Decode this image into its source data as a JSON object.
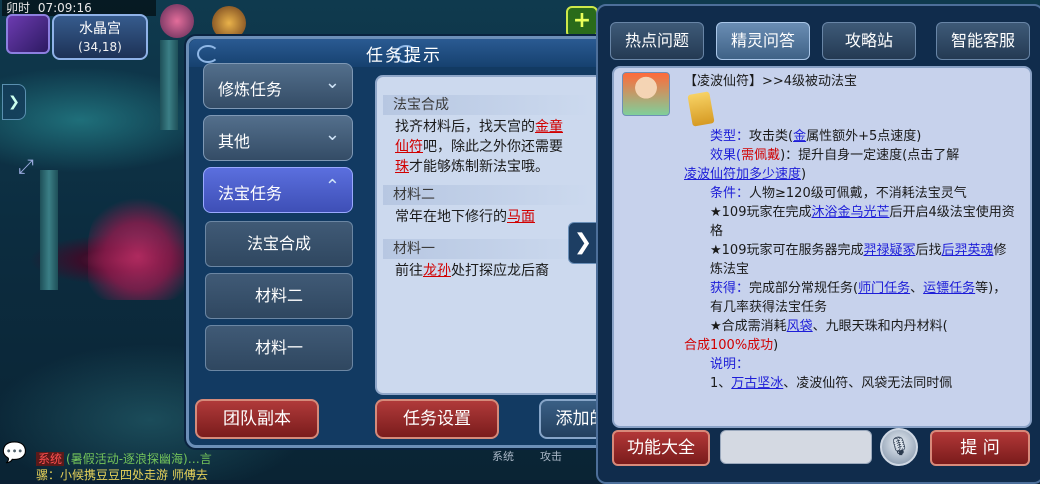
{
  "hud": {
    "period": "卯时",
    "clock": "07:09:16",
    "location_name": "水晶宫",
    "coordinates": "(34,18)"
  },
  "task_dialog": {
    "title": "任务提示",
    "categories": [
      {
        "label": "修炼任务",
        "expanded": false
      },
      {
        "label": "其他",
        "expanded": false
      },
      {
        "label": "法宝任务",
        "expanded": true
      }
    ],
    "sub_items": [
      "法宝合成",
      "材料二",
      "材料一"
    ],
    "sections": [
      {
        "heading": "法宝合成",
        "lines": [
          {
            "pre": "找齐材料后，找天宫的",
            "link": "金童",
            "post": ""
          },
          {
            "pre": "",
            "link": "仙符",
            "post": "吧，除此之外你还需要"
          },
          {
            "pre": "",
            "link": "珠",
            "post": "才能够炼制新法宝哦。"
          }
        ]
      },
      {
        "heading": "材料二",
        "lines": [
          {
            "pre": "常年在地下修行的",
            "link": "马面",
            "post": ""
          }
        ]
      },
      {
        "heading": "材料一",
        "lines": [
          {
            "pre": "前往",
            "link": "龙孙",
            "post": "处打探应龙后裔"
          }
        ]
      }
    ],
    "team_dungeon_label": "团队副本",
    "task_settings_label": "任务设置",
    "add_label": "添加的"
  },
  "qa_panel": {
    "tabs": [
      {
        "label": "热点问题",
        "active": false
      },
      {
        "label": "精灵问答",
        "active": true
      },
      {
        "label": "攻略站",
        "active": false
      },
      {
        "label": "智能客服",
        "active": false
      }
    ],
    "answer": {
      "title": "【凌波仙符】>>4级被动法宝",
      "type_label": "类型：",
      "type_value": "攻击类(",
      "type_element": "金",
      "type_rest": "属性额外+5点速度)",
      "effect_label": "效果(",
      "effect_need": "需佩戴",
      "effect_rest": ")：提升自身一定速度(点击了解",
      "effect_link": "凌波仙符加多少速度",
      "effect_end": ")",
      "cond_label": "条件：",
      "cond_text": "人物≥120级可佩戴，不消耗法宝灵气",
      "star1_pre": "★109玩家在完成",
      "star1_link": "沐浴金乌光芒",
      "star1_post": "后开启4级法宝使用资格",
      "star2_pre": "★109玩家可在服务器完成",
      "star2_link1": "羿禄疑冢",
      "star2_mid": "后找",
      "star2_link2": "后羿英魂",
      "star2_post": "修炼法宝",
      "get_label": "获得：",
      "get_pre": "完成部分常规任务(",
      "get_link1": "师门任务",
      "get_sep": "、",
      "get_link2": "运镖任务",
      "get_post": "等)，有几率获得法宝任务",
      "star3_pre": "★合成需消耗",
      "star3_link": "风袋",
      "star3_post": "、九眼天珠和内丹材料(",
      "star3_red": "合成100%成功",
      "star3_end": ")",
      "note_label": "说明：",
      "note_pre": "1、",
      "note_link": "万古坚冰",
      "note_mid": "、凌波仙符、风袋无法同时佩"
    },
    "functions_label": "功能大全",
    "ask_label": "提 问",
    "input_value": ""
  },
  "chat": {
    "system_tag": "系统",
    "line1": "(暑假活动-逐浪探幽海)…言",
    "line2": "骡：小候携豆豆四处走游  师傅去"
  },
  "bottom_bar": {
    "system_label": "系统",
    "attack_label": "攻击"
  }
}
